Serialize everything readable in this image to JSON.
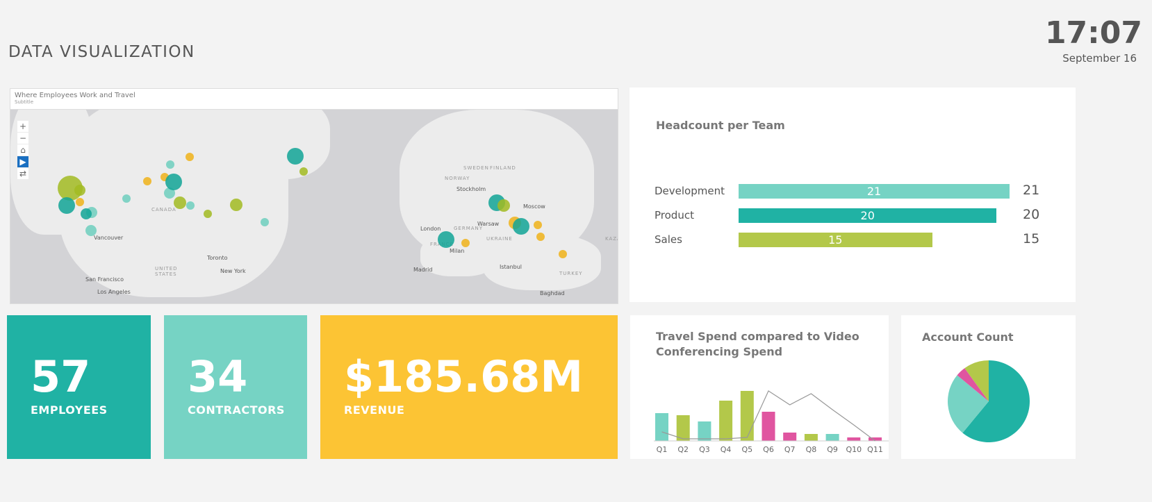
{
  "header": {
    "title": "DATA VISUALIZATION",
    "time": "17:07",
    "date": "September 16"
  },
  "map": {
    "title": "Where Employees Work and Travel",
    "subtitle": "Subtitle",
    "controls": [
      "+",
      "−",
      "⌂",
      "▶",
      "⇄"
    ],
    "labels": [
      "CANADA",
      "Vancouver",
      "San Francisco",
      "Los Angeles",
      "UNITED",
      "STATES",
      "Toronto",
      "New York",
      "SWEDEN",
      "FINLAND",
      "NORWAY",
      "Stockholm",
      "Moscow",
      "London",
      "Warsaw",
      "GERMANY",
      "UKRAINE",
      "FRANCE",
      "Milan",
      "Madrid",
      "Istanbul",
      "TURKEY",
      "Baghdad",
      "KAZAK"
    ],
    "colors": {
      "teal": "#12a596",
      "light_teal": "#6fcfbe",
      "green": "#a2bb22",
      "yellow": "#f0b31a"
    }
  },
  "headcount": {
    "title": "Headcount per Team",
    "max": 21,
    "teams": [
      {
        "label": "Development",
        "value": 21,
        "color": "#76d3c4"
      },
      {
        "label": "Product",
        "value": 20,
        "color": "#20b2a4"
      },
      {
        "label": "Sales",
        "value": 15,
        "color": "#b3c84a"
      }
    ]
  },
  "kpis": [
    {
      "value": "57",
      "label": "EMPLOYEES",
      "color": "#20b2a4"
    },
    {
      "value": "34",
      "label": "CONTRACTORS",
      "color": "#76d3c4"
    },
    {
      "value": "$185.68M",
      "label": "REVENUE",
      "color": "#fcc434"
    }
  ],
  "chart_data": [
    {
      "type": "bar",
      "title": "Travel Spend compared to Video Conferencing Spend",
      "categories": [
        "Q1",
        "Q2",
        "Q3",
        "Q4",
        "Q5",
        "Q6",
        "Q7",
        "Q8",
        "Q9",
        "Q10",
        "Q11"
      ],
      "series": [
        {
          "type": "bar",
          "values": [
            40,
            37,
            28,
            58,
            72,
            42,
            12,
            10,
            10,
            5,
            5
          ],
          "colors": [
            "#76d3c4",
            "#b3c84a",
            "#76d3c4",
            "#b3c84a",
            "#b3c84a",
            "#e055a0",
            "#e055a0",
            "#b3c84a",
            "#76d3c4",
            "#e055a0",
            "#e055a0"
          ]
        },
        {
          "type": "line",
          "values": [
            13,
            3,
            3,
            3,
            5,
            72,
            52,
            68,
            45,
            23,
            0
          ],
          "color": "#999999"
        }
      ]
    },
    {
      "type": "pie",
      "title": "Account Count",
      "values": [
        61,
        25,
        4,
        10
      ],
      "colors": [
        "#20b2a4",
        "#76d3c4",
        "#e055a0",
        "#b3c84a"
      ]
    }
  ]
}
